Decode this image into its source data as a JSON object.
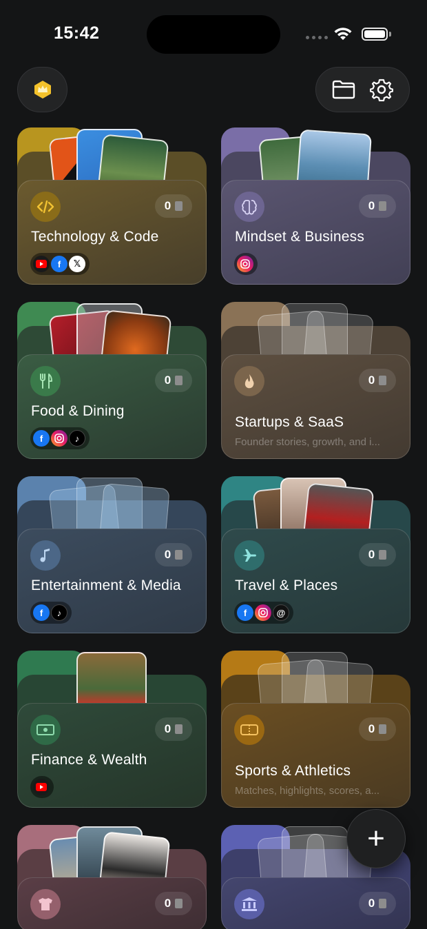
{
  "status_bar": {
    "time": "15:42"
  },
  "header": {
    "crown_icon": "crown-icon",
    "folder_icon": "folder-icon",
    "settings_icon": "gear-icon"
  },
  "categories": [
    {
      "title": "Technology & Code",
      "count": "0",
      "icon": "code-icon",
      "color": "#c9a227",
      "socials": [
        "youtube",
        "facebook",
        "x"
      ]
    },
    {
      "title": "Mindset & Business",
      "count": "0",
      "icon": "brain-icon",
      "color": "#8d83b8",
      "socials": [
        "instagram"
      ]
    },
    {
      "title": "Food & Dining",
      "count": "0",
      "icon": "fork-knife-icon",
      "color": "#4c9a5e",
      "socials": [
        "facebook",
        "instagram",
        "tiktok"
      ]
    },
    {
      "title": "Startups & SaaS",
      "count": "0",
      "icon": "flame-icon",
      "color": "#a3876a",
      "subtitle": "Founder stories, growth, and i..."
    },
    {
      "title": "Entertainment & Media",
      "count": "0",
      "icon": "music-note-icon",
      "color": "#6e93bc",
      "socials": [
        "facebook",
        "tiktok"
      ]
    },
    {
      "title": "Travel & Places",
      "count": "0",
      "icon": "airplane-icon",
      "color": "#3f9a99",
      "socials": [
        "facebook",
        "instagram",
        "threads"
      ]
    },
    {
      "title": "Finance & Wealth",
      "count": "0",
      "icon": "banknote-icon",
      "color": "#3b8a5e",
      "socials": [
        "youtube"
      ]
    },
    {
      "title": "Sports & Athletics",
      "count": "0",
      "icon": "ticket-icon",
      "color": "#c98a1c",
      "subtitle": "Matches, highlights, scores, a..."
    },
    {
      "title": "",
      "count": "0",
      "icon": "tshirt-icon",
      "color": "#c07f8e"
    },
    {
      "title": "",
      "count": "0",
      "icon": "bank-icon",
      "color": "#6f74c8"
    }
  ],
  "fab": {
    "label": "+"
  }
}
